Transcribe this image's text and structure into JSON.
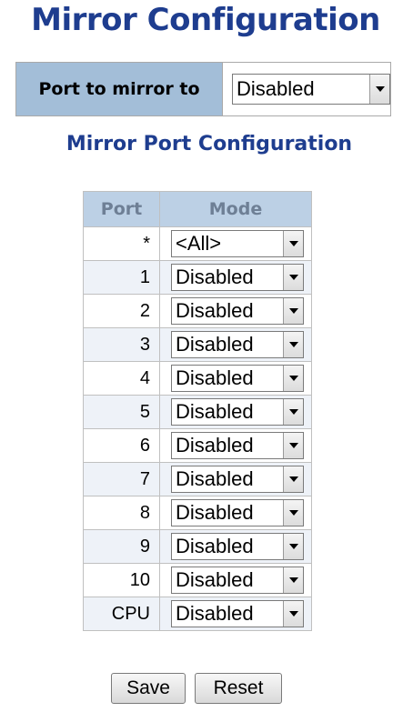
{
  "page": {
    "title": "Mirror Configuration"
  },
  "mirror_to": {
    "label": "Port to mirror to",
    "value": "Disabled"
  },
  "section": {
    "title": "Mirror Port Configuration"
  },
  "table": {
    "headers": {
      "port": "Port",
      "mode": "Mode"
    },
    "rows": [
      {
        "port": "*",
        "mode": "<All>"
      },
      {
        "port": "1",
        "mode": "Disabled"
      },
      {
        "port": "2",
        "mode": "Disabled"
      },
      {
        "port": "3",
        "mode": "Disabled"
      },
      {
        "port": "4",
        "mode": "Disabled"
      },
      {
        "port": "5",
        "mode": "Disabled"
      },
      {
        "port": "6",
        "mode": "Disabled"
      },
      {
        "port": "7",
        "mode": "Disabled"
      },
      {
        "port": "8",
        "mode": "Disabled"
      },
      {
        "port": "9",
        "mode": "Disabled"
      },
      {
        "port": "10",
        "mode": "Disabled"
      },
      {
        "port": "CPU",
        "mode": "Disabled"
      }
    ]
  },
  "buttons": {
    "save": "Save",
    "reset": "Reset"
  },
  "colors": {
    "title": "#1e3d8f",
    "label_bg": "#a3bed8",
    "header_bg": "#bcd0e5",
    "row_alt_bg": "#eef2f8"
  }
}
